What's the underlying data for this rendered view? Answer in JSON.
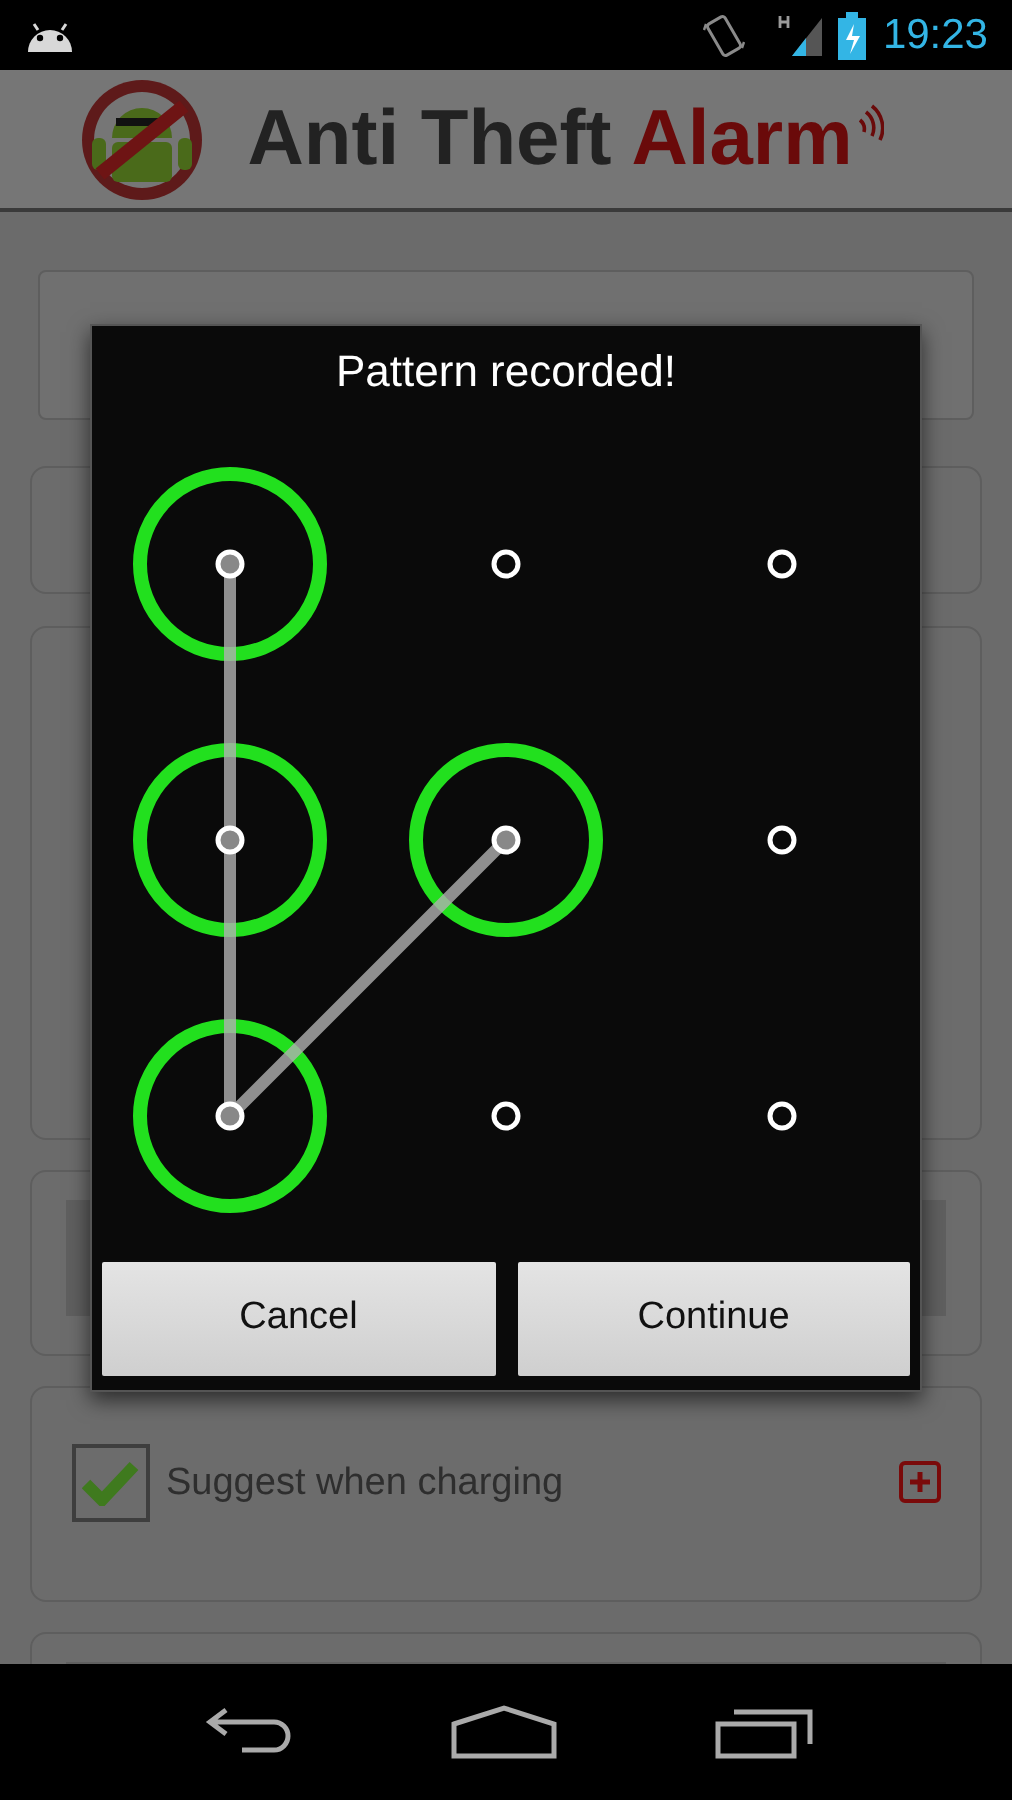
{
  "status_bar": {
    "time": "19:23"
  },
  "header": {
    "title_parts": [
      {
        "text": "Anti Theft",
        "kind": "plain"
      },
      {
        "text": "Alarm",
        "kind": "accent"
      }
    ]
  },
  "background": {
    "cards": [
      {
        "kind": "bar"
      },
      {
        "kind": "plain"
      },
      {
        "kind": "tall"
      },
      {
        "kind": "inner"
      },
      {
        "kind": "checkbox",
        "label": "Suggest when charging",
        "checked": true
      },
      {
        "kind": "inner"
      }
    ]
  },
  "dialog": {
    "title": "Pattern recorded!",
    "nodes": [
      {
        "selected": true
      },
      {
        "selected": false
      },
      {
        "selected": false
      },
      {
        "selected": true
      },
      {
        "selected": true
      },
      {
        "selected": false
      },
      {
        "selected": true
      },
      {
        "selected": false
      },
      {
        "selected": false
      }
    ],
    "buttons": [
      {
        "label": "Cancel"
      },
      {
        "label": "Continue"
      }
    ]
  }
}
